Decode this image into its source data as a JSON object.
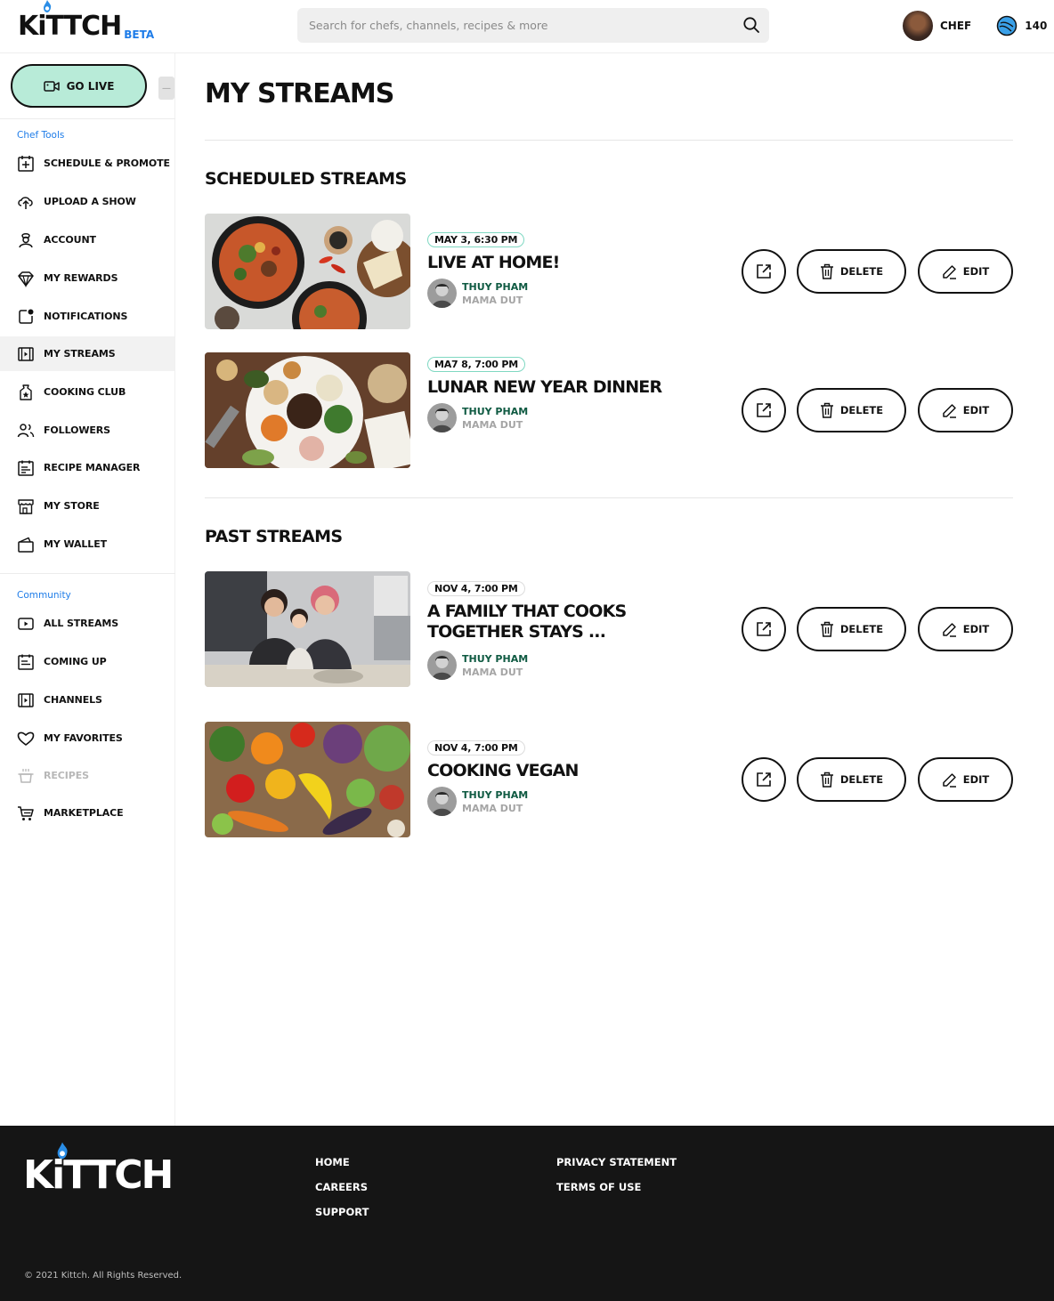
{
  "header": {
    "logo_text": "KiTTCH",
    "logo_badge": "BETA",
    "search_placeholder": "Search for chefs, channels, recipes & more",
    "user_name": "CHEF",
    "coin_count": "140"
  },
  "sidebar": {
    "go_live_label": "GO LIVE",
    "collapse_label": "—",
    "chef_tools_heading": "Chef Tools",
    "chef_tools": [
      {
        "label": "SCHEDULE & PROMOTE",
        "icon": "calendar-plus-icon"
      },
      {
        "label": "UPLOAD A SHOW",
        "icon": "upload-cloud-icon"
      },
      {
        "label": "ACCOUNT",
        "icon": "chef-user-icon"
      },
      {
        "label": "MY REWARDS",
        "icon": "diamond-icon"
      },
      {
        "label": "NOTIFICATIONS",
        "icon": "notification-icon"
      },
      {
        "label": "MY STREAMS",
        "icon": "film-icon"
      },
      {
        "label": "COOKING CLUB",
        "icon": "star-badge-icon"
      },
      {
        "label": "FOLLOWERS",
        "icon": "followers-icon"
      },
      {
        "label": "RECIPE MANAGER",
        "icon": "recipe-icon"
      },
      {
        "label": "MY STORE",
        "icon": "store-icon"
      },
      {
        "label": "MY WALLET",
        "icon": "wallet-icon"
      }
    ],
    "community_heading": "Community",
    "community": [
      {
        "label": "ALL STREAMS",
        "icon": "play-icon"
      },
      {
        "label": "COMING UP",
        "icon": "calendar-icon"
      },
      {
        "label": "CHANNELS",
        "icon": "film-icon"
      },
      {
        "label": "MY FAVORITES",
        "icon": "heart-icon"
      },
      {
        "label": "RECIPES",
        "icon": "pot-icon"
      },
      {
        "label": "MARKETPLACE",
        "icon": "cart-icon"
      }
    ]
  },
  "main": {
    "page_title": "MY STREAMS",
    "scheduled_heading": "SCHEDULED STREAMS",
    "past_heading": "PAST STREAMS",
    "delete_label": "DELETE",
    "edit_label": "EDIT",
    "scheduled": [
      {
        "date": "MAY 3, 6:30 PM",
        "title": "LIVE AT HOME!",
        "chef": "THUY PHAM",
        "channel": "MAMA DUT"
      },
      {
        "date": "MA7 8, 7:00 PM",
        "title": "LUNAR NEW YEAR DINNER",
        "chef": "THUY PHAM",
        "channel": "MAMA DUT"
      }
    ],
    "past": [
      {
        "date": "NOV 4, 7:00 PM",
        "title": "A FAMILY THAT COOKS TOGETHER STAYS ...",
        "chef": "THUY PHAM",
        "channel": "MAMA DUT"
      },
      {
        "date": "NOV 4, 7:00 PM",
        "title": "COOKING VEGAN",
        "chef": "THUY PHAM",
        "channel": "MAMA DUT"
      }
    ]
  },
  "footer": {
    "logo_text": "KiTTCH",
    "links_col1": [
      "HOME",
      "CAREERS",
      "SUPPORT"
    ],
    "links_col2": [
      "PRIVACY STATEMENT",
      "TERMS OF USE"
    ],
    "copyright": "© 2021 Kittch. All Rights Reserved."
  },
  "colors": {
    "accent_blue": "#1e7ce8",
    "go_live_bg": "#b8ebd8",
    "date_border": "#7fd8c2",
    "chef_name": "#0f5a42",
    "footer_bg": "#151515"
  }
}
